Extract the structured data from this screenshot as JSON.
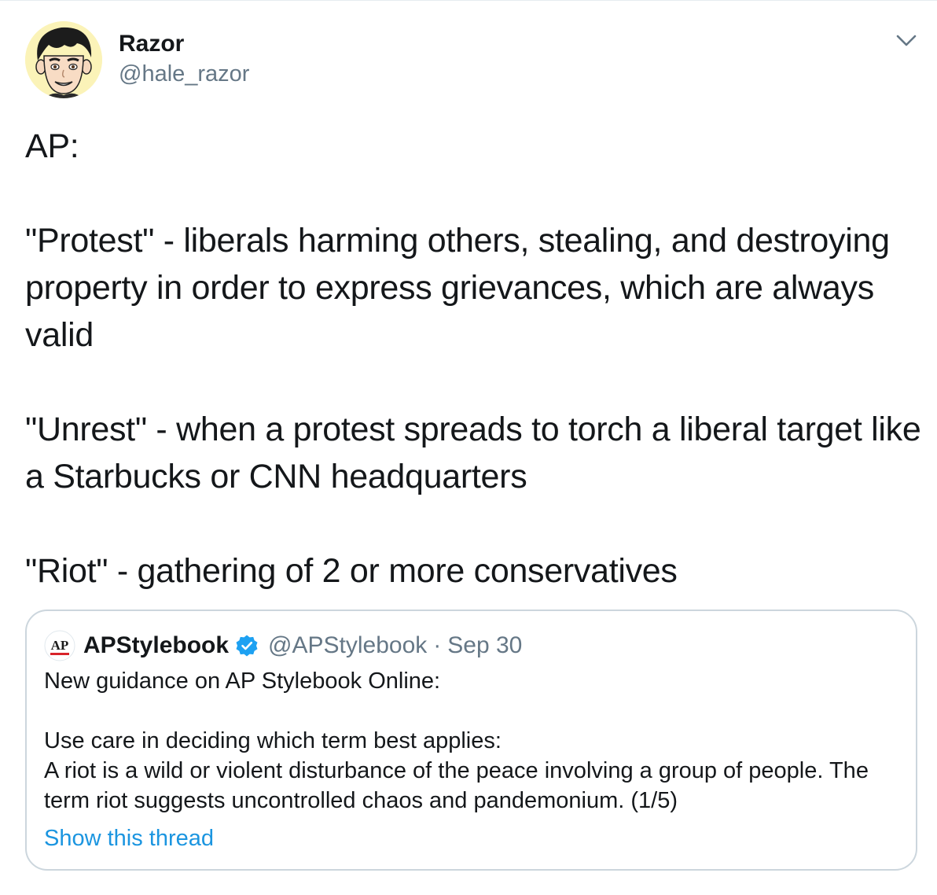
{
  "author": {
    "name": "Razor",
    "handle": "@hale_razor",
    "avatar_icon": "cartoon-face-avatar"
  },
  "menu": {
    "caret_icon": "chevron-down-icon"
  },
  "tweet": {
    "text": "AP:\n\n\"Protest\" - liberals harming others, stealing, and destroying property in order to express grievances, which are always valid\n\n\"Unrest\" - when a protest spreads to torch a liberal target like a Starbucks or CNN headquarters\n\n\"Riot\" - gathering of 2 or more conservatives"
  },
  "quoted_tweet": {
    "logo_text": "AP",
    "name": "APStylebook",
    "verified_icon": "verified-badge-icon",
    "handle": "@APStylebook",
    "separator": "·",
    "date": "Sep 30",
    "text": "New guidance on AP Stylebook Online:\n\nUse care in deciding which term best applies:\nA riot is a wild or violent disturbance of the peace involving a group of people. The term riot suggests uncontrolled chaos and pandemonium. (1/5)",
    "show_thread_label": "Show this thread"
  },
  "colors": {
    "text_primary": "#14171a",
    "text_secondary": "#657786",
    "link": "#1b95e0",
    "verified": "#1da1f2",
    "border": "#ccd6dd"
  }
}
